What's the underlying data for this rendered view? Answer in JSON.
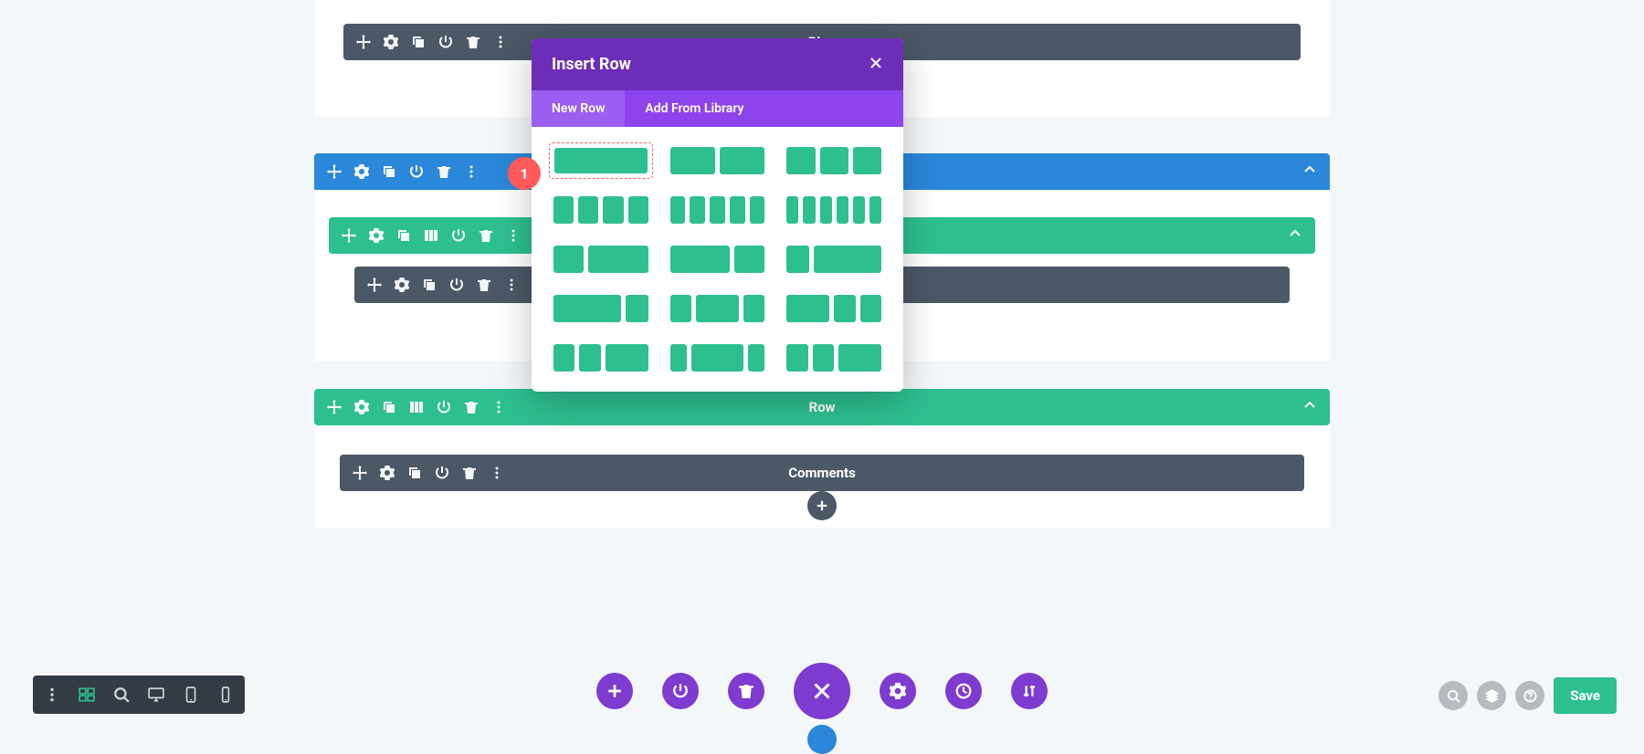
{
  "modal": {
    "title": "Insert Row",
    "tabs": {
      "new_row": "New Row",
      "add_library": "Add From Library"
    }
  },
  "modules": {
    "blog": "Blog",
    "row": "Row",
    "comments": "Comments"
  },
  "annotation": {
    "step1": "1"
  },
  "bottom": {
    "save": "Save"
  }
}
